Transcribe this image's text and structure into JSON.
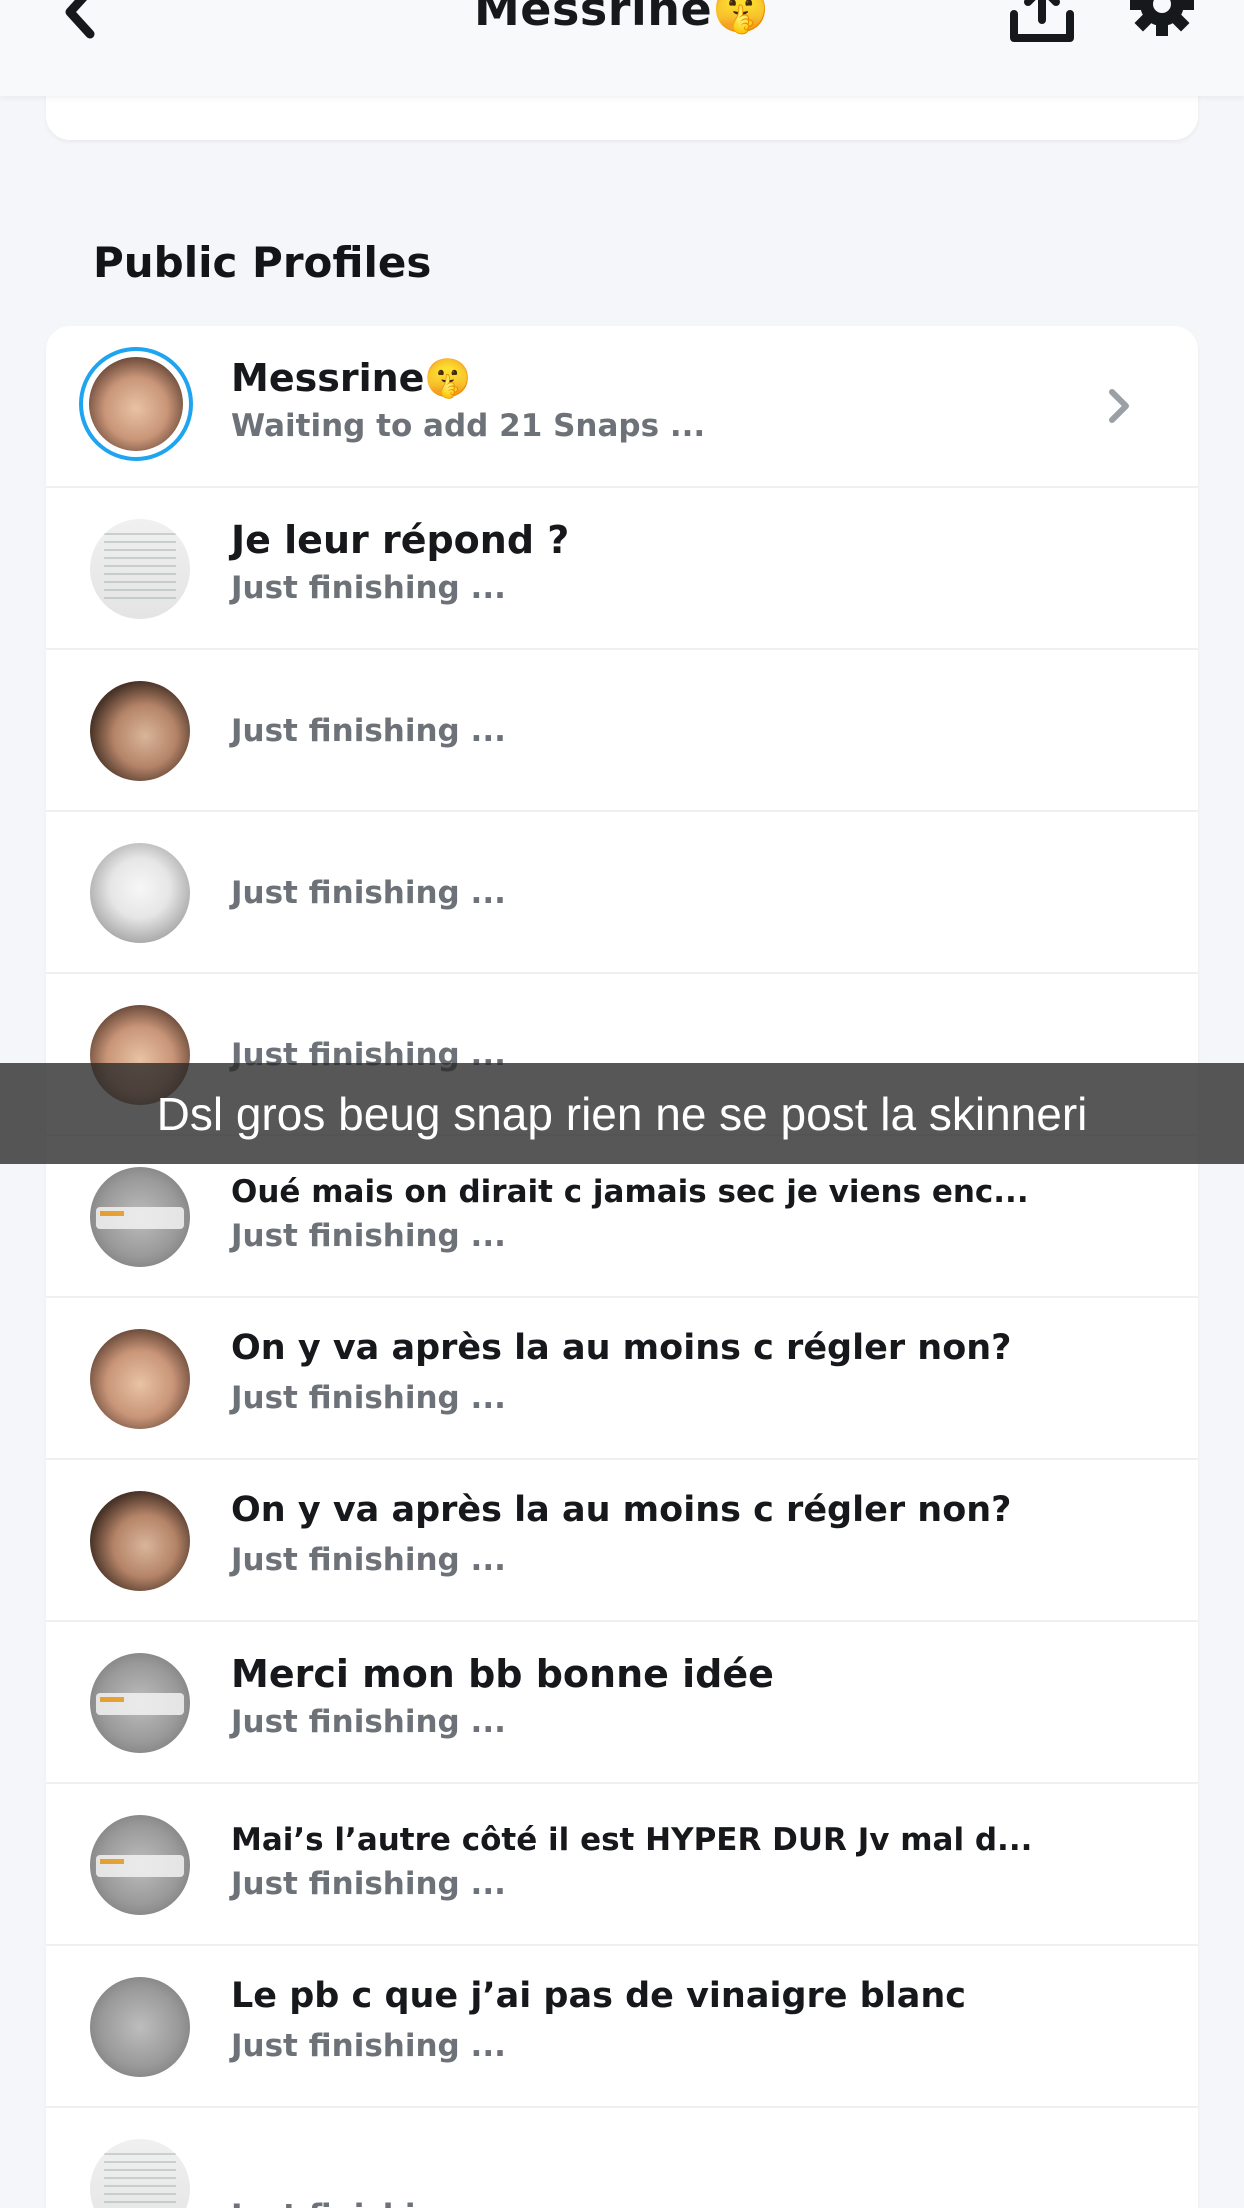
{
  "header": {
    "title": "Messrine🤫",
    "icons": {
      "back": "chevron-left-icon",
      "upload": "upload-icon",
      "settings": "gear-icon"
    }
  },
  "section": {
    "title": "Public Profiles"
  },
  "profile_rows": [
    {
      "title": "Messrine🤫",
      "subtitle": "Waiting to add 21 Snaps ...",
      "avatar": "profile-ring"
    },
    {
      "title": "Je leur répond ?",
      "subtitle": "Just finishing ...",
      "avatar": "document"
    },
    {
      "title": "",
      "subtitle": "Just finishing ...",
      "avatar": "face"
    },
    {
      "title": "",
      "subtitle": "Just finishing ...",
      "avatar": "white-cloth"
    },
    {
      "title": "",
      "subtitle": "Just finishing ...",
      "avatar": "face"
    },
    {
      "title": "Oué mais on dirait c jamais sec je viens enc...",
      "subtitle": "Just finishing ...",
      "avatar": "gray-photo"
    },
    {
      "title": "On y va après la au moins c régler non?",
      "subtitle": "Just finishing ...",
      "avatar": "face"
    },
    {
      "title": "On y va après la au moins c régler non?",
      "subtitle": "Just finishing ...",
      "avatar": "face"
    },
    {
      "title": "Merci mon bb bonne idée",
      "subtitle": "Just finishing ...",
      "avatar": "gray-photo"
    },
    {
      "title": "Mai’s l’autre côté il est HYPER DUR Jv mal d...",
      "subtitle": "Just finishing ...",
      "avatar": "gray-photo"
    },
    {
      "title": "Le pb c que j’ai pas de vinaigre blanc",
      "subtitle": "Just finishing ...",
      "avatar": "gray-photo"
    },
    {
      "title": "",
      "subtitle": "Just finishing ...",
      "avatar": "document"
    }
  ],
  "caption": {
    "text": "Dsl gros beug snap rien ne se post la skinneri"
  },
  "colors": {
    "accent_ring": "#1fa4f0",
    "background": "#f4f6f9",
    "subtitle": "#6d7278"
  }
}
